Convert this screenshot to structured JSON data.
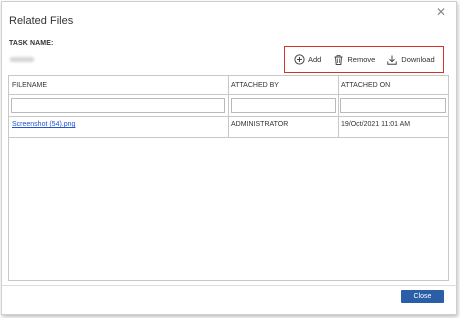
{
  "dialog": {
    "title": "Related Files",
    "close_icon": "close-icon"
  },
  "task": {
    "label": "TASK NAME:"
  },
  "toolbar": {
    "add_label": "Add",
    "remove_label": "Remove",
    "download_label": "Download",
    "highlight_color": "#d0342c"
  },
  "grid": {
    "columns": [
      "FILENAME",
      "ATTACHED BY",
      "ATTACHED ON"
    ],
    "rows": [
      {
        "filename": "Screenshot (54).png",
        "attached_by": "ADMINISTRATOR",
        "attached_on": "19/Oct/2021 11:01 AM"
      }
    ]
  },
  "footer": {
    "close_label": "Close",
    "button_color": "#2a5fa8"
  }
}
